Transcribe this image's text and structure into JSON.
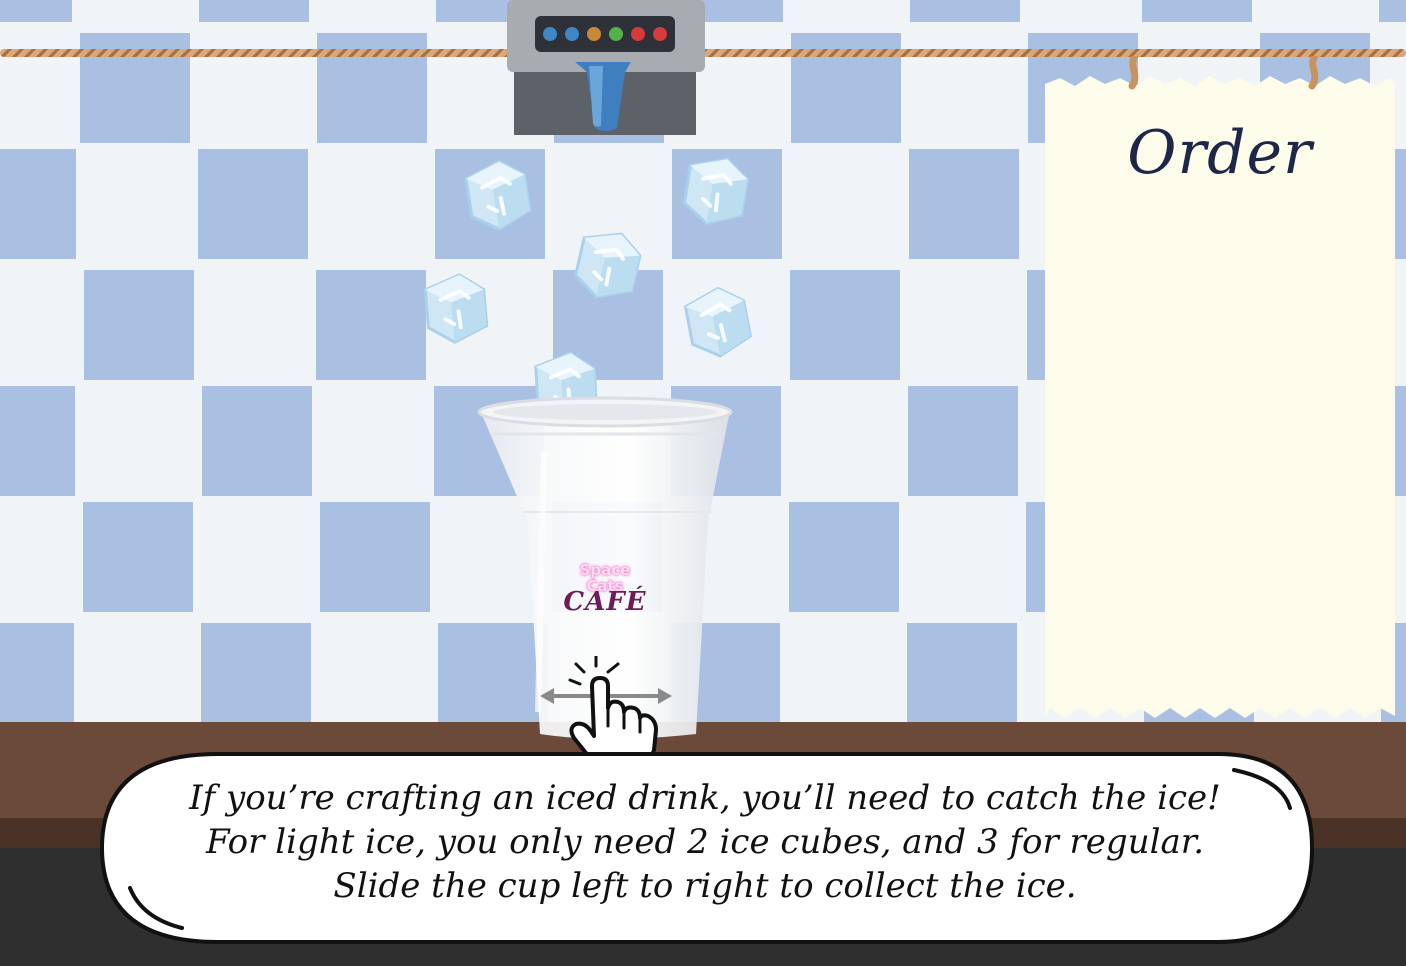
{
  "order": {
    "title": "Order"
  },
  "cup_logo": {
    "line1": "Space",
    "line2": "Cats",
    "line3": "CAFÉ"
  },
  "instructions": {
    "line1": "If you’re crafting an iced drink, you’ll need to catch the ice!",
    "line2": "For light ice, you only need 2 ice cubes, and 3 for regular.",
    "line3": "Slide the cup left to right to collect the ice."
  },
  "dispenser": {
    "indicator_colors": [
      "#3f86c6",
      "#3f86c6",
      "#c88a3a",
      "#55b14a",
      "#d63a3a",
      "#d63a3a"
    ]
  },
  "icons": {
    "ice_cube": "ice-cube-icon",
    "swipe_hand": "swipe-hand-icon",
    "double_arrow": "double-arrow-icon"
  },
  "colors": {
    "tile_blue": "#aac0e2",
    "wall_white": "#f1f4f6",
    "counter": "#6b4a39",
    "paper": "#fdfbe9",
    "order_text": "#1e2748"
  }
}
